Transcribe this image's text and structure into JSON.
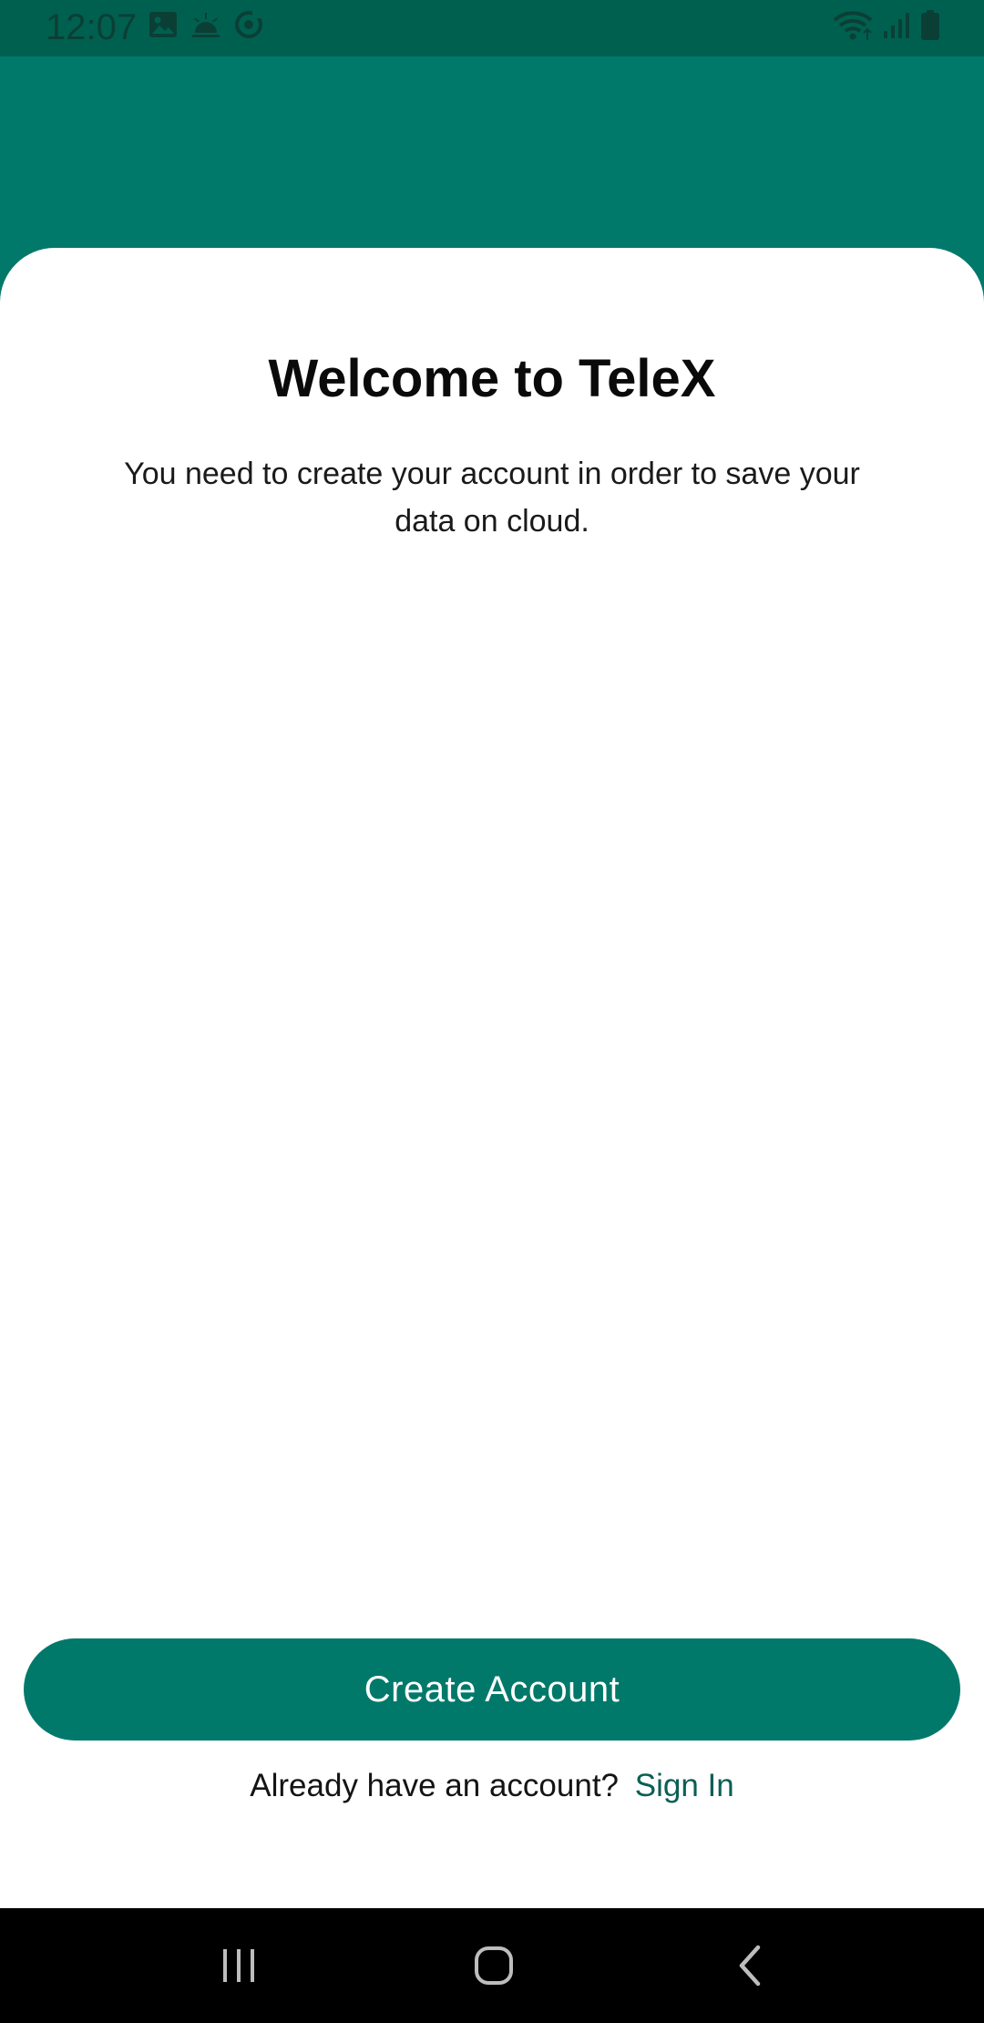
{
  "status_bar": {
    "time": "12:07",
    "left_icons": [
      "image-icon",
      "weather-icon",
      "sync-icon"
    ],
    "right_icons": [
      "wifi-icon",
      "signal-icon",
      "battery-icon"
    ]
  },
  "welcome": {
    "title": "Welcome to TeleX",
    "subtitle": "You need to create your account in order to save your data on cloud."
  },
  "actions": {
    "create_account_label": "Create Account",
    "already_have_account_text": "Already have an account?",
    "sign_in_label": "Sign In"
  },
  "nav_bar": {
    "buttons": [
      "recents-icon",
      "home-icon",
      "back-icon"
    ]
  },
  "colors": {
    "primary": "#00796a",
    "status_bar": "#00604f",
    "link": "#0b5f55",
    "background": "#ffffff"
  }
}
